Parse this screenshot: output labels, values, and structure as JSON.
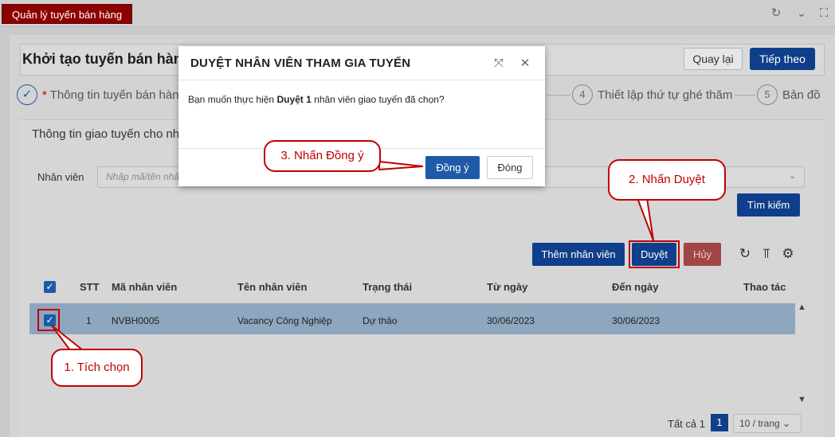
{
  "app": {
    "tab_label": "Quản lý tuyến bán hàng",
    "icons": [
      "refresh-icon",
      "chevron-down-icon",
      "fullscreen-icon"
    ]
  },
  "header": {
    "title": "Khởi tạo tuyến bán hàng",
    "back_label": "Quay lại",
    "next_label": "Tiếp theo"
  },
  "steps": [
    {
      "number": "✓",
      "label": "Thông tin tuyến bán hàng",
      "required": "*"
    },
    {
      "number": "4",
      "label": "Thiết lập thứ tự ghé thăm"
    },
    {
      "number": "5",
      "label": "Bản đồ"
    }
  ],
  "section": {
    "title": "Thông tin giao tuyến cho nhân",
    "employee_label": "Nhân viên",
    "employee_placeholder": "Nhập mã/tên nhân",
    "search_label": "Tìm kiếm"
  },
  "toolbar": {
    "add_label": "Thêm nhân viên",
    "approve_label": "Duyệt",
    "cancel_label": "Hủy"
  },
  "table": {
    "headers": [
      "STT",
      "Mã nhân viên",
      "Tên nhân viên",
      "Trạng thái",
      "Từ ngày",
      "Đến ngày",
      "Thao tác"
    ],
    "rows": [
      {
        "stt": "1",
        "code": "NVBH0005",
        "name": "Vacancy Công Nghiệp",
        "status": "Dự thảo",
        "from": "30/06/2023",
        "to": "30/06/2023",
        "checked": true
      }
    ]
  },
  "pager": {
    "total": "Tất cả 1",
    "page": "1",
    "size": "10 / trang"
  },
  "modal": {
    "title": "DUYỆT NHÂN VIÊN THAM GIA TUYẾN",
    "body_prefix": "Bạn muốn thực hiện",
    "body_bold": "Duyệt 1",
    "body_suffix": "nhân viên giao tuyến đã chọn?",
    "confirm_label": "Đồng ý",
    "close_label": "Đóng"
  },
  "callouts": {
    "step1": "1. Tích chọn",
    "step2": "2. Nhấn Duyệt",
    "step3": "3. Nhấn Đồng ý"
  },
  "colors": {
    "brand_red": "#8e0000",
    "primary_blue": "#0f3f8a",
    "callout_red": "#c00000"
  }
}
